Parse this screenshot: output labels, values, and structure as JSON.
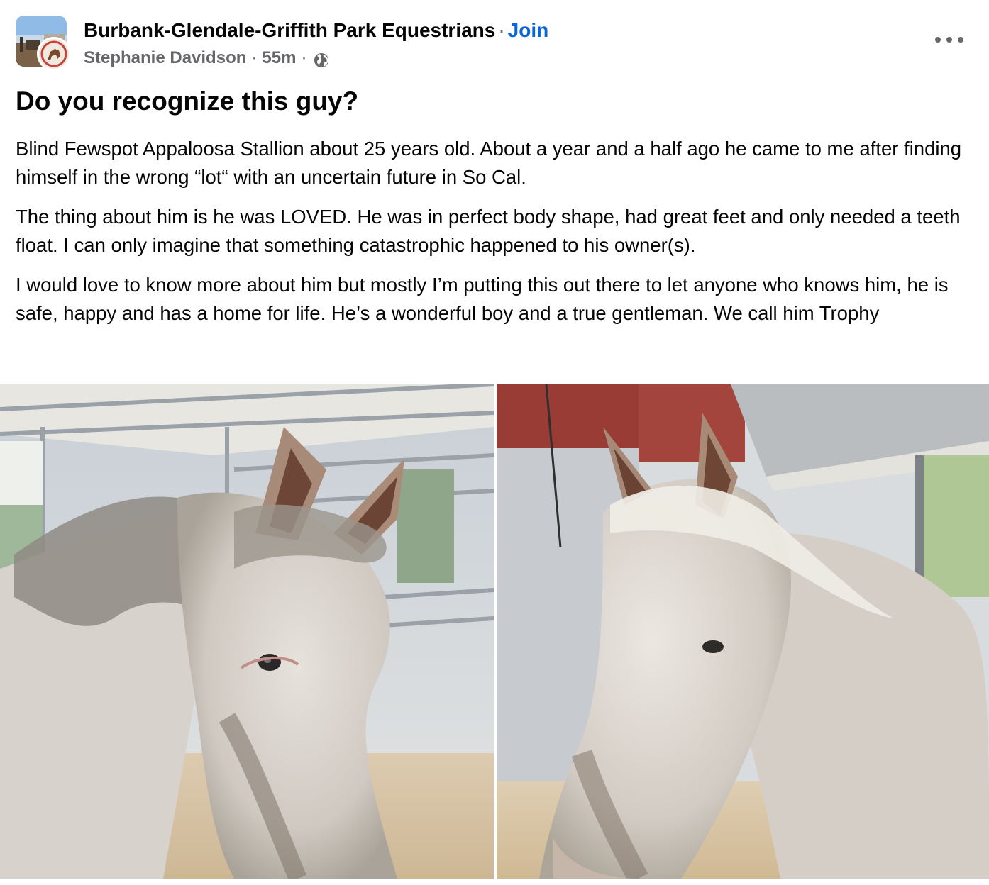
{
  "header": {
    "group_name": "Burbank-Glendale-Griffith Park Equestrians",
    "join_separator": "·",
    "join_label": "Join",
    "author": "Stephanie Davidson",
    "time": "55m",
    "audience_icon": "globe-icon",
    "more_icon": "more-options-icon"
  },
  "post": {
    "title": "Do you recognize this guy?",
    "paragraphs": [
      "Blind Fewspot Appaloosa Stallion about 25 years old. About a year and a half ago he came to me after finding himself in the wrong “lot“ with an uncertain future in So Cal.",
      "The thing about him is he was LOVED. He was in perfect body shape, had great feet and only needed a teeth float. I can only imagine that something catastrophic happened to his owner(s).",
      "I would love to know more about him but mostly I’m putting this out there to let anyone who knows him, he is safe, happy and has a home for life. He’s a wonderful boy and a true gentleman. We call him Trophy"
    ]
  },
  "colors": {
    "link_blue": "#0a66d8",
    "secondary_text": "#65676b",
    "primary_text": "#050505"
  }
}
